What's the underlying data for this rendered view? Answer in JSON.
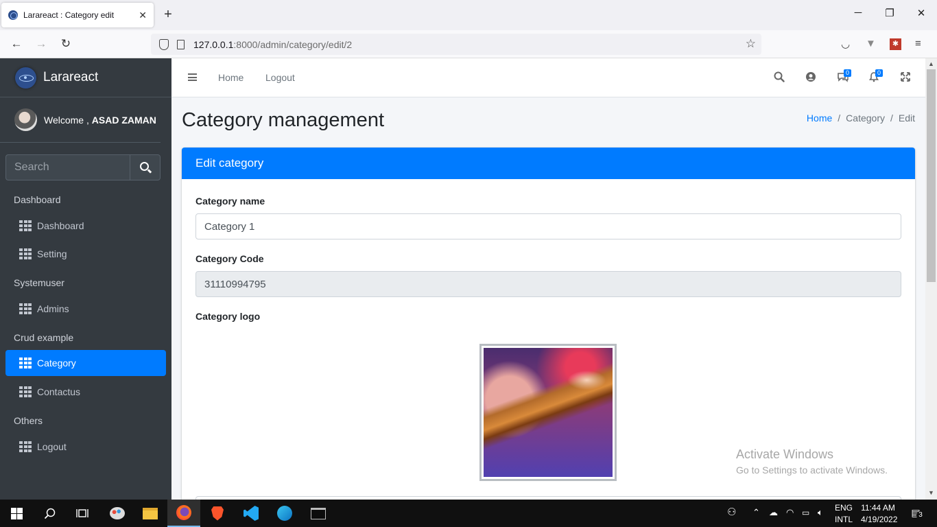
{
  "browser": {
    "tab_title": "Larareact : Category edit",
    "tab_close": "✕",
    "new_tab": "+",
    "url_host": "127.0.0.1",
    "url_rest": ":8000/admin/category/edit/2",
    "window_controls": [
      "─",
      "❐",
      "✕"
    ]
  },
  "sidebar": {
    "brand": "Larareact",
    "welcome": "Welcome ,",
    "user_name": "ASAD ZAMAN",
    "search_placeholder": "Search",
    "sections": [
      {
        "header": "Dashboard",
        "items": [
          "Dashboard",
          "Setting"
        ]
      },
      {
        "header": "Systemuser",
        "items": [
          "Admins"
        ]
      },
      {
        "header": "Crud example",
        "items": [
          "Category",
          "Contactus"
        ]
      },
      {
        "header": "Others",
        "items": [
          "Logout"
        ]
      }
    ],
    "active_item": "Category"
  },
  "topnav": {
    "home": "Home",
    "logout": "Logout",
    "messages_count": "0",
    "notifications_count": "0"
  },
  "page": {
    "title": "Category management",
    "breadcrumb": [
      "Home",
      "Category",
      "Edit"
    ],
    "breadcrumb_sep": "/"
  },
  "form": {
    "card_title": "Edit category",
    "name_label": "Category name",
    "name_value": "Category 1",
    "code_label": "Category Code",
    "code_value": "31110994795",
    "logo_label": "Category logo"
  },
  "watermark": {
    "line1": "Activate Windows",
    "line2": "Go to Settings to activate Windows."
  },
  "taskbar": {
    "lang1": "ENG",
    "lang2": "INTL",
    "time": "11:44 AM",
    "date": "4/19/2022",
    "notification_count": "3"
  },
  "colors": {
    "primary": "#007bff",
    "sidebar_bg": "#343a40"
  }
}
